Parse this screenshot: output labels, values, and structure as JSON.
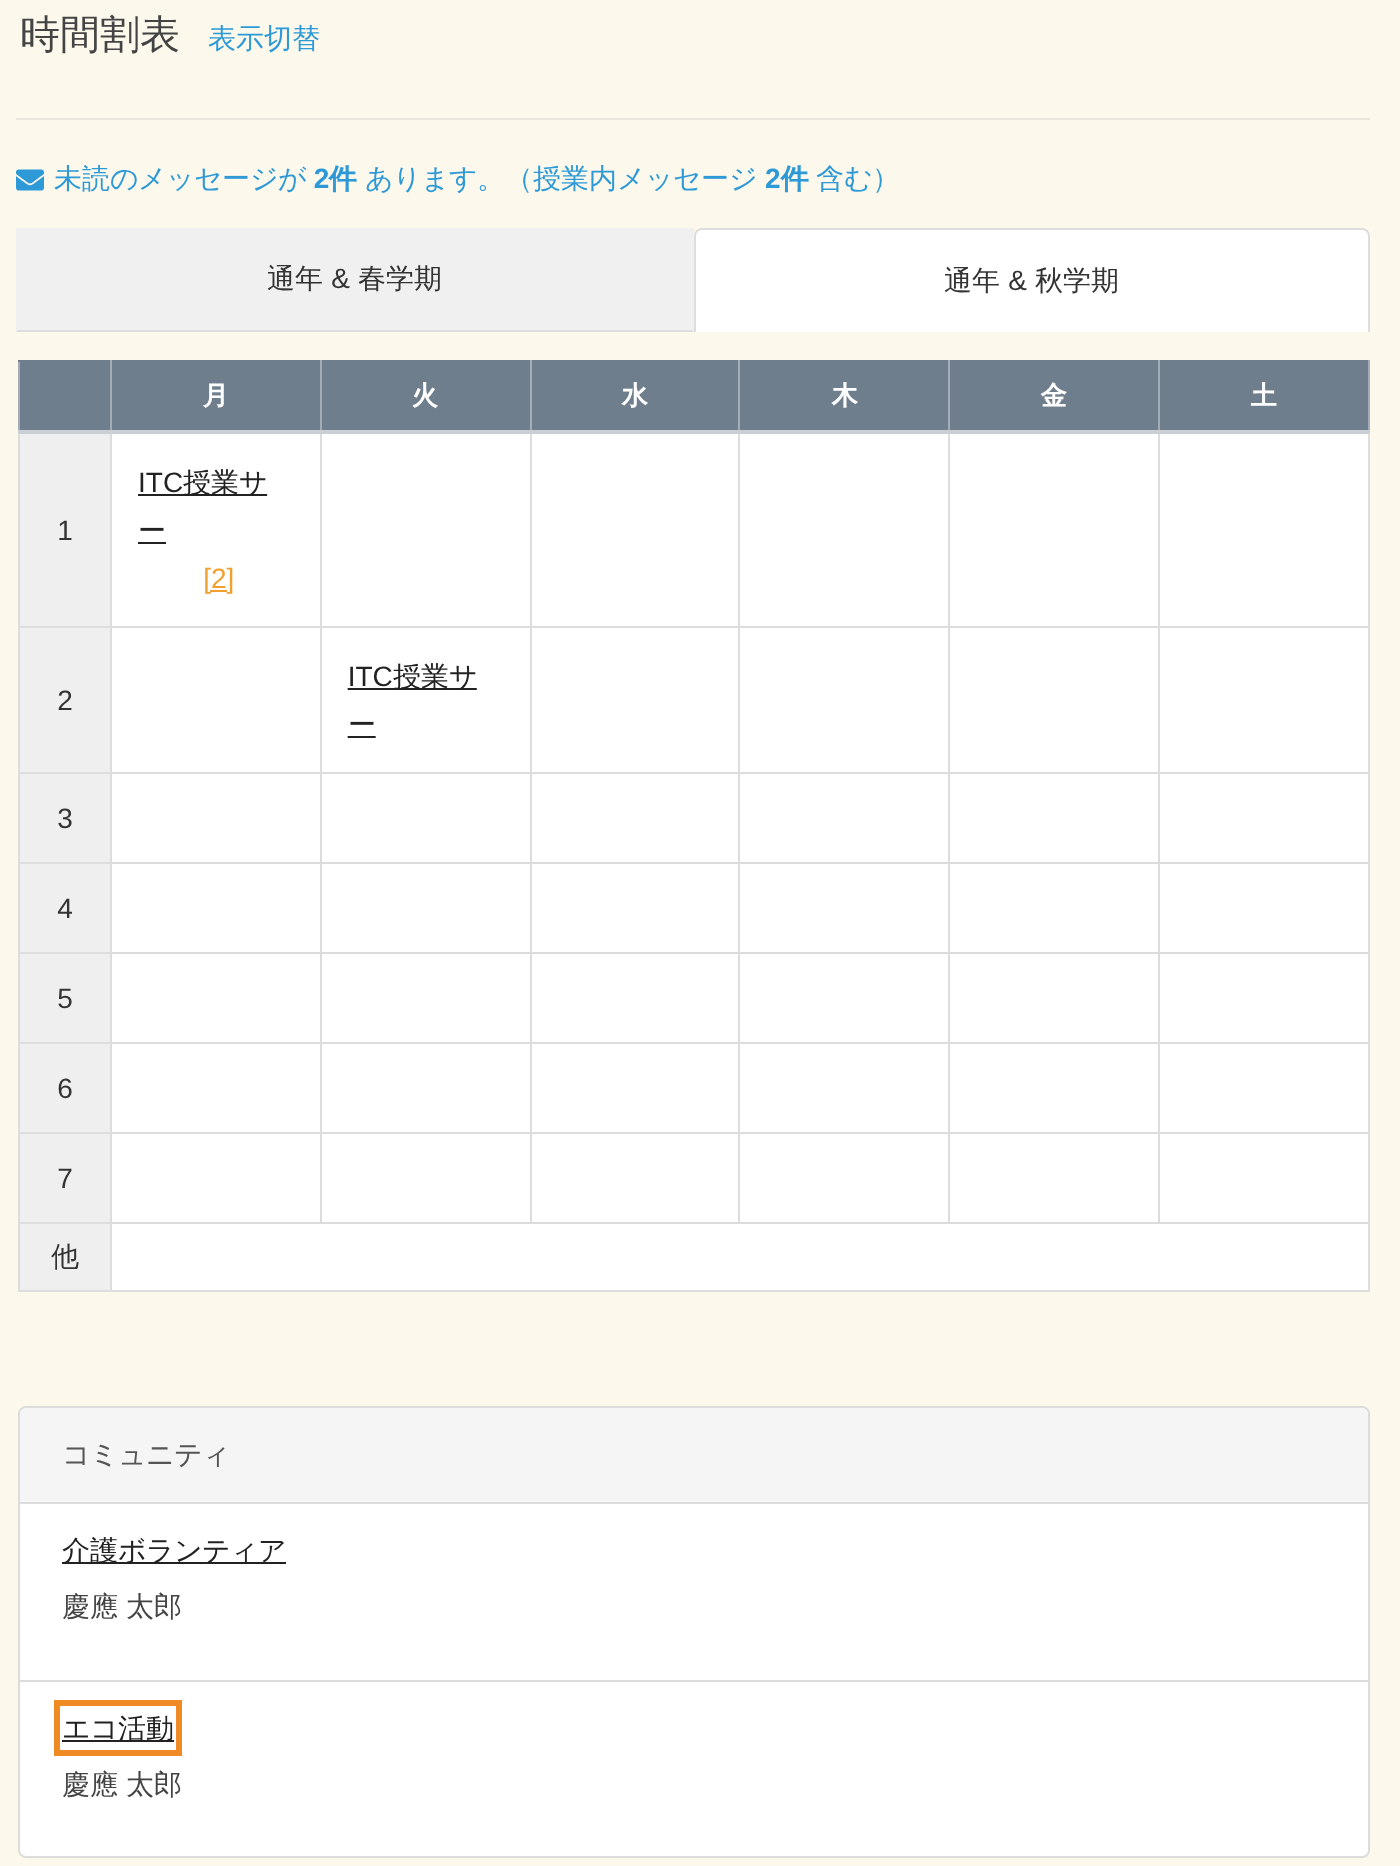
{
  "header": {
    "title": "時間割表",
    "toggle_link": "表示切替"
  },
  "message": {
    "text": "未読のメッセージが **2件** あります。（授業内メッセージ **2件** 含む）"
  },
  "tabs": [
    {
      "label": "通年 & 春学期",
      "selected": false
    },
    {
      "label": "通年 & 秋学期",
      "selected": true
    }
  ],
  "timetable": {
    "columns": [
      "月",
      "火",
      "水",
      "木",
      "金",
      "土"
    ],
    "rows": [
      {
        "kind": "period",
        "period": "1",
        "cells": [
          {
            "kind": "course",
            "title": "ITC授業サー",
            "badge": "[2]"
          },
          {
            "kind": "empty"
          },
          {
            "kind": "empty"
          },
          {
            "kind": "empty"
          },
          {
            "kind": "empty"
          },
          {
            "kind": "empty"
          }
        ]
      },
      {
        "kind": "period",
        "period": "2",
        "cells": [
          {
            "kind": "empty"
          },
          {
            "kind": "course",
            "title": "ITC授業サー"
          },
          {
            "kind": "empty"
          },
          {
            "kind": "empty"
          },
          {
            "kind": "empty"
          },
          {
            "kind": "empty"
          }
        ]
      },
      {
        "kind": "period",
        "period": "3",
        "cells": [
          {
            "kind": "empty"
          },
          {
            "kind": "empty"
          },
          {
            "kind": "empty"
          },
          {
            "kind": "empty"
          },
          {
            "kind": "empty"
          },
          {
            "kind": "empty"
          }
        ]
      },
      {
        "kind": "period",
        "period": "4",
        "cells": [
          {
            "kind": "empty"
          },
          {
            "kind": "empty"
          },
          {
            "kind": "empty"
          },
          {
            "kind": "empty"
          },
          {
            "kind": "empty"
          },
          {
            "kind": "empty"
          }
        ]
      },
      {
        "kind": "period",
        "period": "5",
        "cells": [
          {
            "kind": "empty"
          },
          {
            "kind": "empty"
          },
          {
            "kind": "empty"
          },
          {
            "kind": "empty"
          },
          {
            "kind": "empty"
          },
          {
            "kind": "empty"
          }
        ]
      },
      {
        "kind": "period",
        "period": "6",
        "cells": [
          {
            "kind": "empty"
          },
          {
            "kind": "empty"
          },
          {
            "kind": "empty"
          },
          {
            "kind": "empty"
          },
          {
            "kind": "empty"
          },
          {
            "kind": "empty"
          }
        ]
      },
      {
        "kind": "period",
        "period": "7",
        "cells": [
          {
            "kind": "empty"
          },
          {
            "kind": "empty"
          },
          {
            "kind": "empty"
          },
          {
            "kind": "empty"
          },
          {
            "kind": "empty"
          },
          {
            "kind": "empty"
          }
        ]
      },
      {
        "kind": "other",
        "period": "他"
      }
    ]
  },
  "community": {
    "title": "コミュニティ",
    "items": [
      {
        "name": "介護ボランティア",
        "owner": "慶應 太郎",
        "focused": false
      },
      {
        "name": "エコ活動",
        "owner": "慶應 太郎",
        "focused": true
      }
    ]
  }
}
